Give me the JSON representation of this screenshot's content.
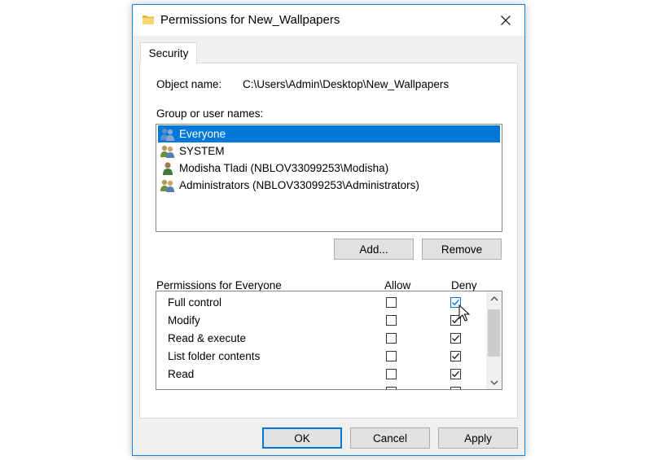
{
  "window": {
    "title": "Permissions for New_Wallpapers",
    "icons": {
      "folder": "folder-icon",
      "close": "close-icon"
    }
  },
  "tabs": [
    {
      "label": "Security",
      "active": true
    }
  ],
  "object": {
    "label": "Object name:",
    "value": "C:\\Users\\Admin\\Desktop\\New_Wallpapers"
  },
  "groups": {
    "label": "Group or user names:",
    "items": [
      {
        "label": "Everyone",
        "icon": "users-icon",
        "selected": true
      },
      {
        "label": "SYSTEM",
        "icon": "users-icon",
        "selected": false
      },
      {
        "label": "Modisha Tladi (NBLOV33099253\\Modisha)",
        "icon": "user-icon",
        "selected": false
      },
      {
        "label": "Administrators (NBLOV33099253\\Administrators)",
        "icon": "users-icon",
        "selected": false
      }
    ]
  },
  "buttons": {
    "add": "Add...",
    "remove": "Remove",
    "ok": "OK",
    "cancel": "Cancel",
    "apply": "Apply"
  },
  "permissions": {
    "label": "Permissions for Everyone",
    "allow_header": "Allow",
    "deny_header": "Deny",
    "rows": [
      {
        "name": "Full control",
        "allow": false,
        "deny": true
      },
      {
        "name": "Modify",
        "allow": false,
        "deny": true
      },
      {
        "name": "Read & execute",
        "allow": false,
        "deny": true
      },
      {
        "name": "List folder contents",
        "allow": false,
        "deny": true
      },
      {
        "name": "Read",
        "allow": false,
        "deny": true
      }
    ]
  },
  "colors": {
    "accent": "#0078d7",
    "border_blue": "#1883d7",
    "dialog_bg": "#f0f0f0"
  }
}
